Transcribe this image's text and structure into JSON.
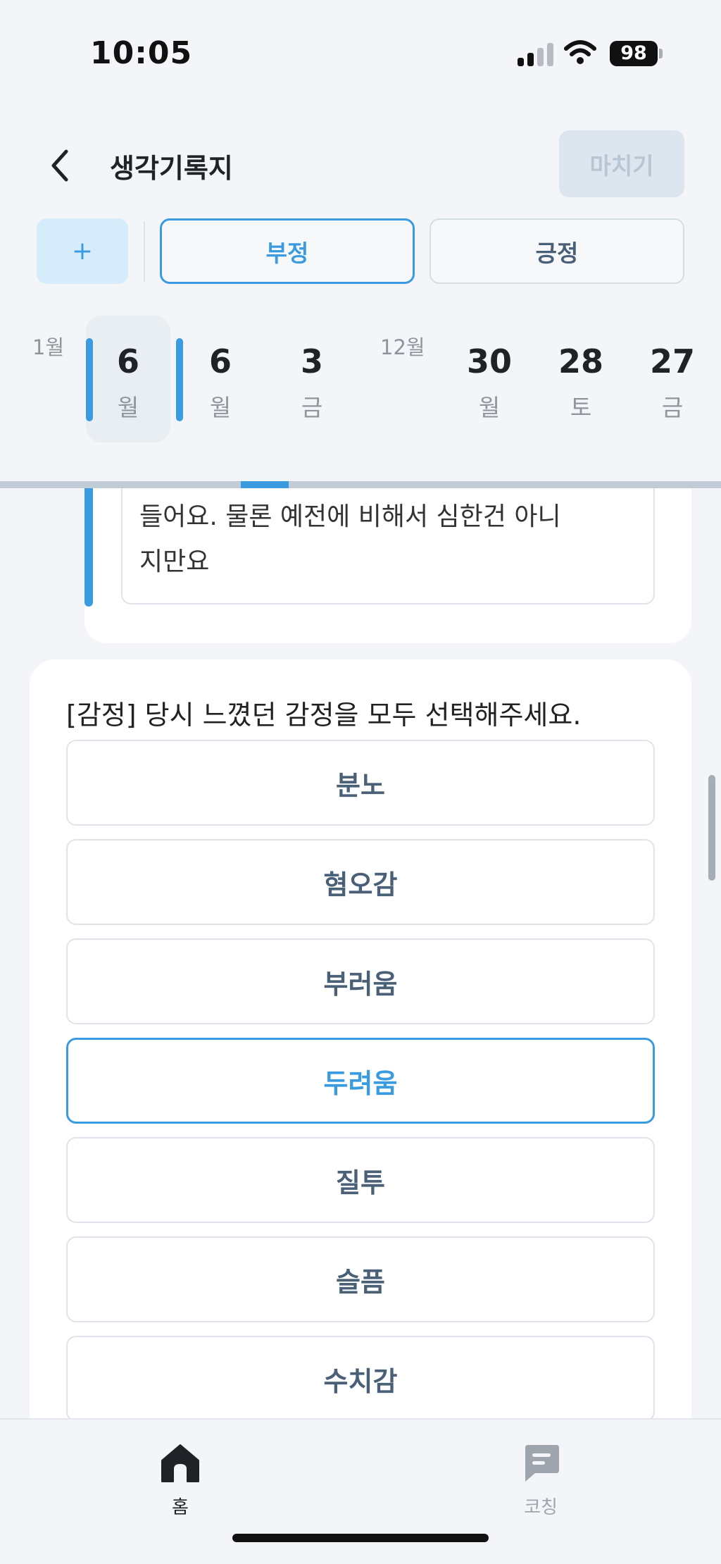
{
  "status_bar": {
    "time": "10:05",
    "battery": "98"
  },
  "header": {
    "title": "생각기록지",
    "finish_label": "마치기"
  },
  "filters": {
    "add_label": "+",
    "negative_label": "부정",
    "positive_label": "긍정"
  },
  "date_strip": {
    "months": [
      "1월",
      "12월"
    ],
    "dates": [
      {
        "day": "6",
        "weekday": "월",
        "selected": true
      },
      {
        "day": "6",
        "weekday": "월",
        "selected": false
      },
      {
        "day": "3",
        "weekday": "금",
        "selected": false
      },
      {
        "day": "30",
        "weekday": "월",
        "selected": false
      },
      {
        "day": "28",
        "weekday": "토",
        "selected": false
      },
      {
        "day": "27",
        "weekday": "금",
        "selected": false
      }
    ]
  },
  "previous_answer": {
    "line1": "들어요. 물론 예전에 비해서 심한건 아니",
    "line2": "지만요"
  },
  "emotion_question": {
    "text": "[감정] 당시 느꼈던 감정을 모두 선택해주세요.",
    "options": [
      "분노",
      "혐오감",
      "부러움",
      "두려움",
      "질투",
      "슬픔",
      "수치감"
    ],
    "selected": "두려움"
  },
  "bottom_nav": {
    "home_label": "홈",
    "coaching_label": "코칭"
  },
  "colors": {
    "accent": "#3a9be0",
    "option_text": "#4a6077",
    "background": "#f3f5f8"
  }
}
